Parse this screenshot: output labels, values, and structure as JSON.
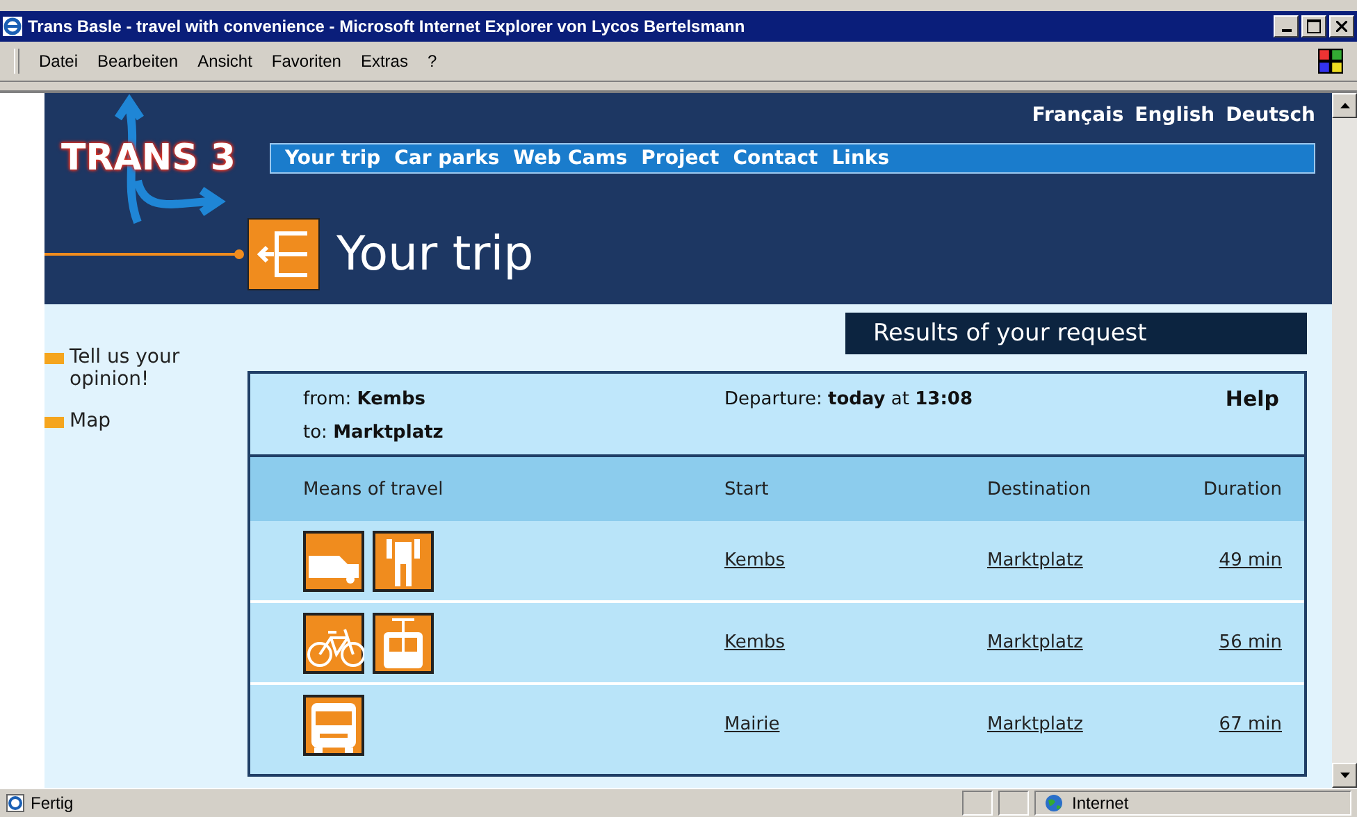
{
  "window": {
    "title": "Trans Basle - travel with convenience - Microsoft Internet Explorer von Lycos Bertelsmann"
  },
  "menu": [
    "Datei",
    "Bearbeiten",
    "Ansicht",
    "Favoriten",
    "Extras",
    "?"
  ],
  "languages": [
    "Français",
    "English",
    "Deutsch"
  ],
  "logo": "TRANS 3",
  "nav": [
    "Your trip",
    "Car parks",
    "Web Cams",
    "Project",
    "Contact",
    "Links"
  ],
  "page_title": "Your trip",
  "sidebar": [
    "Tell us your opinion!",
    "Map"
  ],
  "results_title": "Results of your request",
  "query": {
    "from_label": "from:",
    "from": "Kembs",
    "to_label": "to:",
    "to": "Marktplatz",
    "departure_label": "Departure:",
    "departure": "**today** at **13:08**",
    "help": "Help"
  },
  "columns": [
    "Means of travel",
    "Start",
    "Destination",
    "Duration"
  ],
  "rows": [
    {
      "means": [
        {
          "kind": "car"
        },
        {
          "kind": "walk"
        }
      ],
      "start": "Kembs",
      "destination": "Marktplatz",
      "duration": "49 min"
    },
    {
      "means": [
        {
          "kind": "bike"
        },
        {
          "kind": "tram"
        }
      ],
      "start": "Kembs",
      "destination": "Marktplatz",
      "duration": "56 min"
    },
    {
      "means": [
        {
          "kind": "bus"
        }
      ],
      "start": "Mairie",
      "destination": "Marktplatz",
      "duration": "67 min"
    }
  ],
  "status_bar": {
    "text": "Fertig",
    "zone": "Internet"
  }
}
